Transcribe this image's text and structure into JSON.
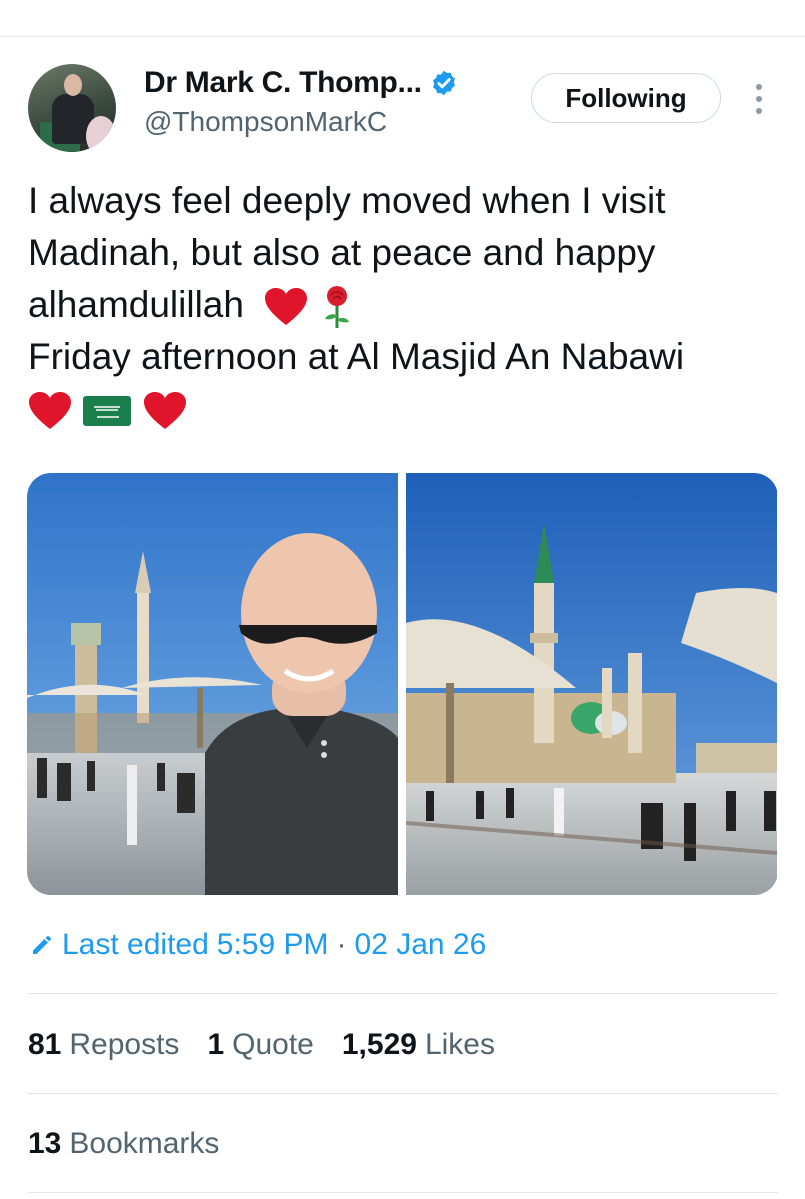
{
  "author": {
    "display_name": "Dr Mark C. Thomp...",
    "handle": "@ThompsonMarkC",
    "verified": true
  },
  "follow_button_label": "Following",
  "tweet": {
    "lines": [
      "I always feel deeply moved when I visit",
      "Madinah, but also at peace and happy",
      "alhamdulillah",
      "Friday afternoon at Al Masjid An Nabawi"
    ],
    "emojis": [
      "red-heart",
      "rose",
      "red-heart",
      "saudi-flag",
      "red-heart"
    ]
  },
  "edit_info": {
    "label": "Last edited",
    "time": "5:59 PM",
    "separator": "·",
    "date": "02 Jan 26"
  },
  "stats": [
    {
      "count": "81",
      "label": "Reposts"
    },
    {
      "count": "1",
      "label": "Quote"
    },
    {
      "count": "1,529",
      "label": "Likes"
    }
  ],
  "bookmarks": {
    "count": "13",
    "label": "Bookmarks"
  },
  "colors": {
    "accent": "#1d9bf0",
    "text": "#0f1419",
    "secondary": "#536471",
    "border": "#cfd9de",
    "heart": "#e0152b",
    "flag_green": "#1a7f4b"
  }
}
